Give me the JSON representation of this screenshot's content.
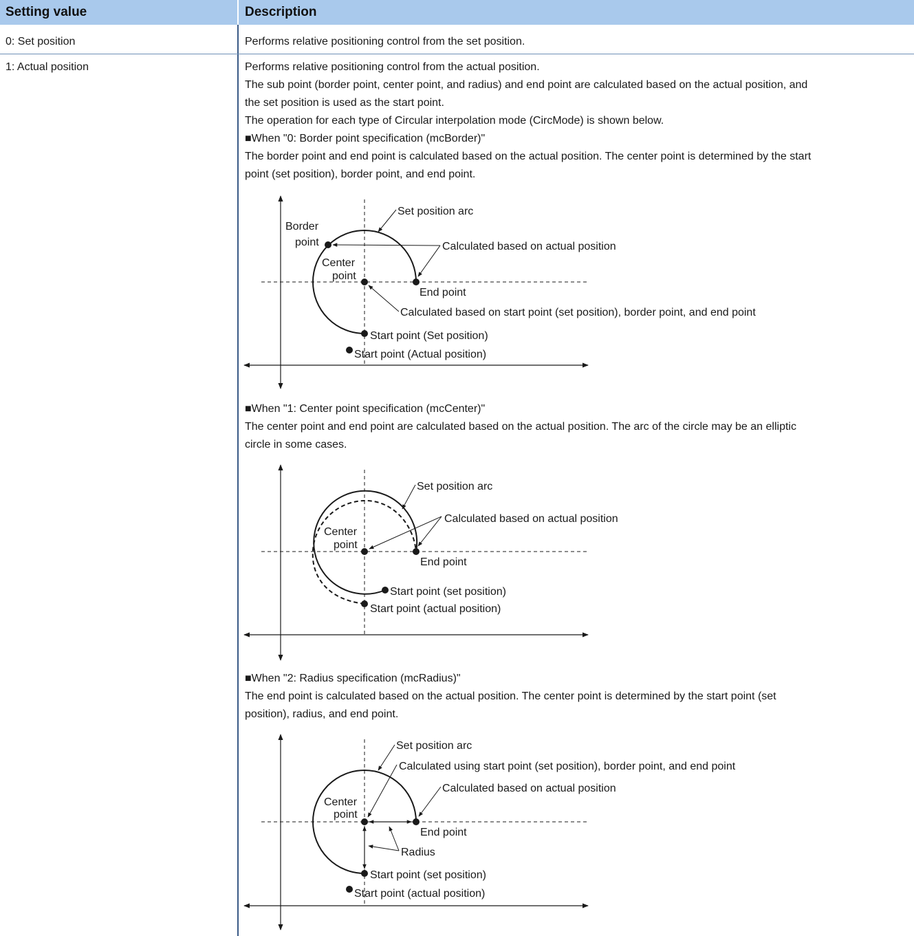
{
  "table": {
    "headers": [
      "Setting value",
      "Description"
    ],
    "rows": [
      {
        "value": "0: Set position",
        "description": "Performs relative positioning control from the set position."
      },
      {
        "value": "1: Actual position"
      }
    ]
  },
  "actual": {
    "lines": [
      "Performs relative positioning control from the actual position.",
      "The sub point (border point, center point, and radius) and end point are calculated based on the actual position, and",
      "the set position is used as the start point.",
      "The operation for each type of Circular interpolation mode (CircMode) is shown below."
    ],
    "border": {
      "heading": "■When \"0: Border point specification (mcBorder)\"",
      "lines": [
        "The border point and end point is calculated based on the actual position. The center point is determined by the start",
        "point (set position), border point, and end point."
      ],
      "labels": {
        "arc": "Set position arc",
        "border1": "Border",
        "border2": "point",
        "calc_actual": "Calculated based on actual position",
        "center1": "Center",
        "center2": "point",
        "end": "End point",
        "calc_center": "Calculated based on start point (set position), border point, and end point",
        "start_set": "Start point (Set position)",
        "start_actual": "Start point (Actual position)"
      }
    },
    "center": {
      "heading": "■When \"1: Center point specification (mcCenter)\"",
      "lines": [
        "The center point and end point are calculated based on the actual position. The arc of the circle may be an elliptic",
        "circle in some cases."
      ],
      "labels": {
        "arc": "Set position arc",
        "calc_actual": "Calculated based on actual position",
        "center1": "Center",
        "center2": "point",
        "end": "End point",
        "start_set": "Start point (set position)",
        "start_actual": "Start point (actual position)"
      }
    },
    "radius": {
      "heading": "■When \"2: Radius specification (mcRadius)\"",
      "lines": [
        "The end point is calculated based on the actual position. The center point is determined by the start point (set",
        "position), radius, and end point."
      ],
      "labels": {
        "arc": "Set position arc",
        "calc_using": "Calculated using start point (set position), border point, and end point",
        "calc_actual": "Calculated based on actual position",
        "center1": "Center",
        "center2": "point",
        "end": "End point",
        "radius": "Radius",
        "start_set": "Start point (set position)",
        "start_actual": "Start point (actual position)"
      }
    }
  }
}
